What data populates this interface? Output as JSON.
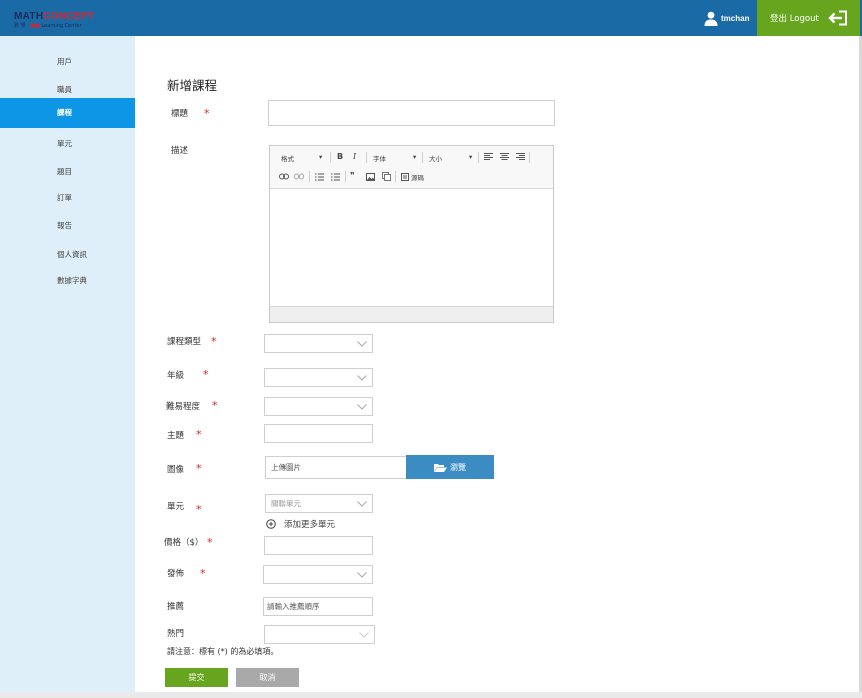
{
  "header": {
    "logo_main_a": "MATH",
    "logo_main_b": "CONCEPT",
    "logo_sub_a": "數 學 ·",
    "logo_sub_b": "Learning Center",
    "username": "tmchan",
    "logout_label": "登出 Logout",
    "bar_color": "#1a6aa6",
    "logout_color": "#68a51e"
  },
  "sidebar": {
    "items": [
      {
        "label": "用戶",
        "active": false
      },
      {
        "label": "職員",
        "active": false
      },
      {
        "label": "課程",
        "active": true
      },
      {
        "label": "單元",
        "active": false
      },
      {
        "label": "題目",
        "active": false
      },
      {
        "label": "訂單",
        "active": false
      },
      {
        "label": "報告",
        "active": false
      },
      {
        "label": "個人資訊",
        "active": false
      },
      {
        "label": "數據字典",
        "active": false
      }
    ]
  },
  "form": {
    "title": "新增課程",
    "required_mark": "*",
    "fields": {
      "title_label": "標題",
      "desc_label": "描述",
      "category_label": "課程類型",
      "grade_label": "年級",
      "difficulty_label": "難易程度",
      "topic_label": "主題",
      "image_label": "圖像",
      "image_placeholder": "上傳圖片",
      "browse_label": "瀏覽",
      "unit_label": "單元",
      "unit_placeholder": "關聯單元",
      "add_unit_label": "添加更多單元",
      "price_label": "價格（$）",
      "publish_label": "發佈",
      "recommend_label": "推薦",
      "recommend_placeholder": "請輸入推薦順序",
      "hot_label": "熱門"
    },
    "editor": {
      "format_label": "格式",
      "font_label": "字体",
      "size_label": "大小",
      "bold": "B",
      "italic": "I",
      "source_label": "源碼",
      "quote": "❞"
    },
    "note": "請注意：標有 (*) 的為必填項。",
    "submit_label": "提交",
    "cancel_label": "取消",
    "submit_color": "#68a51e",
    "cancel_color": "#a9a9a9"
  }
}
